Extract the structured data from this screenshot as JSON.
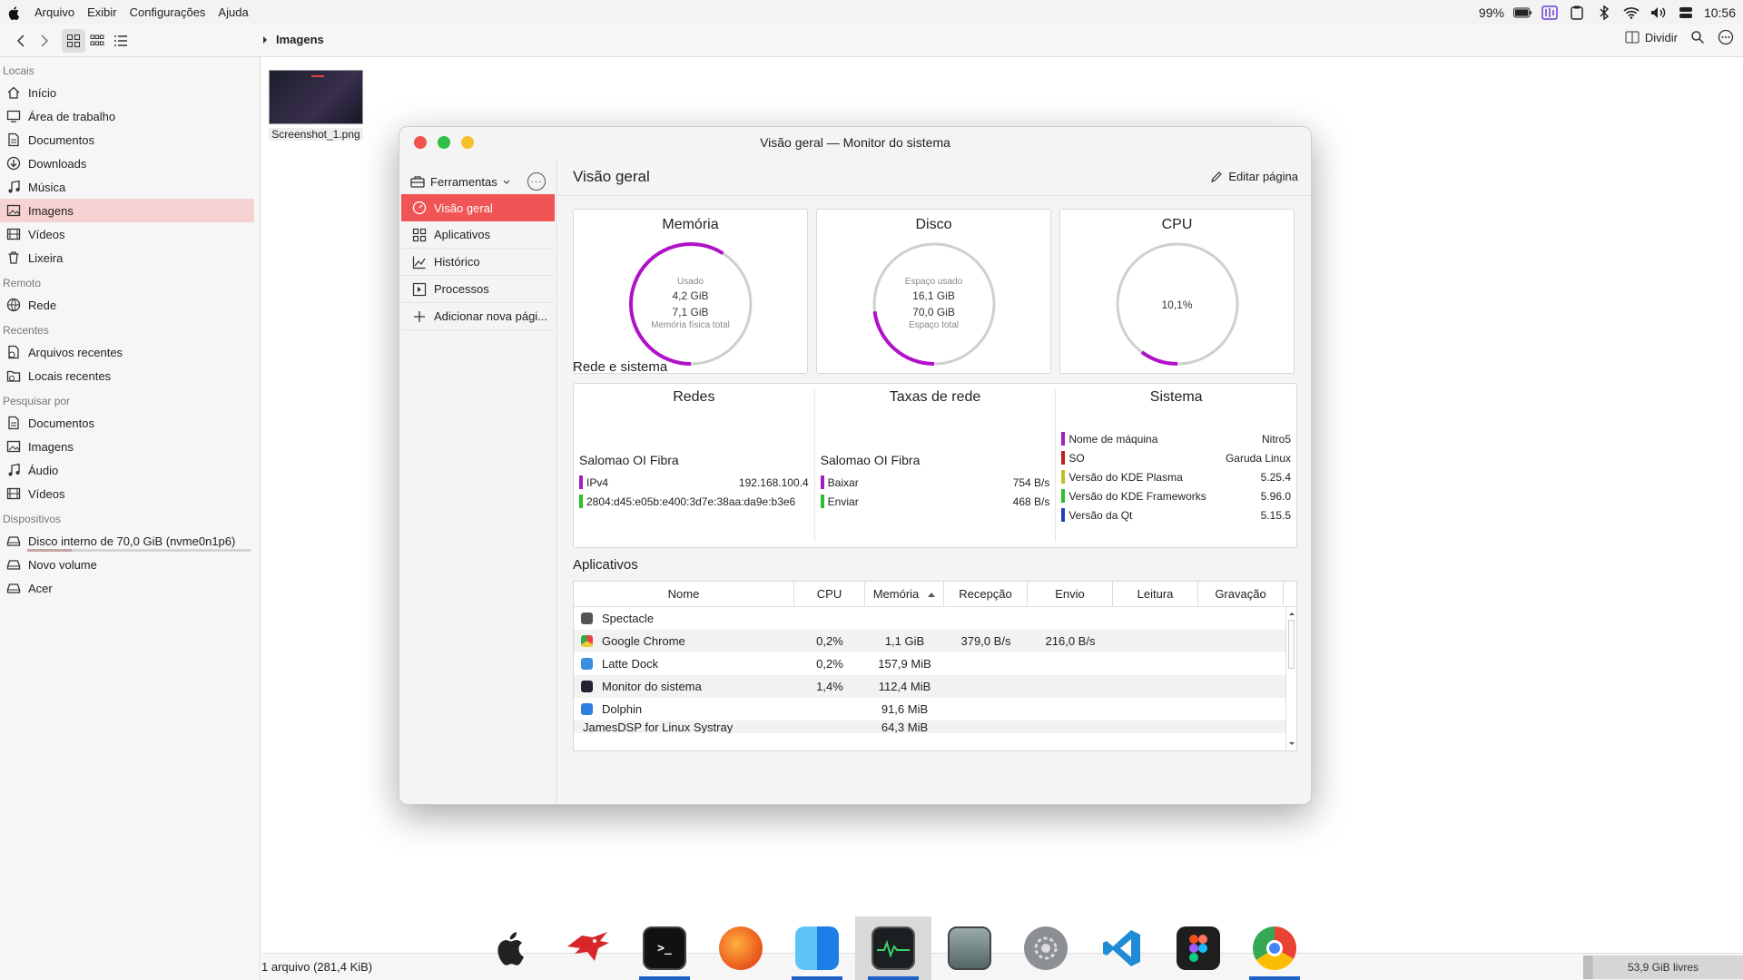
{
  "menubar": {
    "menus": [
      "Arquivo",
      "Exibir",
      "Configurações",
      "Ajuda"
    ],
    "battery": "99%",
    "clock": "10:56"
  },
  "toolbar": {
    "breadcrumb": "Imagens",
    "split_label": "Dividir"
  },
  "sidebar": {
    "sections": {
      "locais": "Locais",
      "remoto": "Remoto",
      "recentes": "Recentes",
      "pesquisar": "Pesquisar por",
      "dispositivos": "Dispositivos"
    },
    "locais": [
      "Início",
      "Área de trabalho",
      "Documentos",
      "Downloads",
      "Música",
      "Imagens",
      "Vídeos",
      "Lixeira"
    ],
    "remoto": [
      "Rede"
    ],
    "recentes": [
      "Arquivos recentes",
      "Locais recentes"
    ],
    "pesquisar": [
      "Documentos",
      "Imagens",
      "Áudio",
      "Vídeos"
    ],
    "dispositivos": [
      "Disco interno de 70,0 GiB (nvme0n1p6)",
      "Novo volume",
      "Acer"
    ],
    "selected": "Imagens"
  },
  "files": [
    {
      "name": "Screenshot_1.png"
    }
  ],
  "statusbar": {
    "summary": "1 arquivo (281,4 KiB)",
    "free": "53,9 GiB livres"
  },
  "window": {
    "title": "Visão geral — Monitor do sistema",
    "tools_label": "Ferramentas",
    "nav": [
      "Visão geral",
      "Aplicativos",
      "Histórico",
      "Processos",
      "Adicionar nova pági..."
    ],
    "page_title": "Visão geral",
    "edit_label": "Editar página",
    "cards": {
      "memory": {
        "title": "Memória",
        "used_label": "Usado",
        "used": "4,2 GiB",
        "total": "7,1 GiB",
        "total_label": "Memória física total",
        "fraction": 0.59
      },
      "disk": {
        "title": "Disco",
        "used_label": "Espaço usado",
        "used": "16,1 GiB",
        "total": "70,0 GiB",
        "total_label": "Espaço total",
        "fraction": 0.23
      },
      "cpu": {
        "title": "CPU",
        "value": "10,1%",
        "fraction": 0.101
      }
    },
    "net_section_title": "Rede e sistema",
    "networks": {
      "title": "Redes",
      "name": "Salomao OI Fibra",
      "rows": [
        {
          "label": "IPv4",
          "value": "192.168.100.4",
          "color": "#a020c0"
        },
        {
          "label": "2804:d45:e05b:e400:3d7e:38aa:da9e:b3e6",
          "value": "",
          "color": "#2cc02c"
        }
      ]
    },
    "rates": {
      "title": "Taxas de rede",
      "name": "Salomao OI Fibra",
      "rows": [
        {
          "label": "Baixar",
          "value": "754 B/s",
          "color": "#a020c0"
        },
        {
          "label": "Enviar",
          "value": "468 B/s",
          "color": "#2cc02c"
        }
      ]
    },
    "system": {
      "title": "Sistema",
      "rows": [
        {
          "label": "Nome de máquina",
          "value": "Nitro5",
          "color": "#a020c0"
        },
        {
          "label": "SO",
          "value": "Garuda Linux",
          "color": "#c02020"
        },
        {
          "label": "Versão do KDE Plasma",
          "value": "5.25.4",
          "color": "#c0c020"
        },
        {
          "label": "Versão do KDE Frameworks",
          "value": "5.96.0",
          "color": "#2cc02c"
        },
        {
          "label": "Versão da Qt",
          "value": "5.15.5",
          "color": "#2040c0"
        }
      ]
    },
    "apps_section_title": "Aplicativos",
    "table": {
      "headers": [
        "Nome",
        "CPU",
        "Memória",
        "Recepção",
        "Envio",
        "Leitura",
        "Gravação"
      ],
      "rows": [
        {
          "name": "Spectacle",
          "cpu": "",
          "mem": "",
          "rx": "",
          "tx": "",
          "icon": "#555"
        },
        {
          "name": "Google Chrome",
          "cpu": "0,2%",
          "mem": "1,1 GiB",
          "rx": "379,0 B/s",
          "tx": "216,0 B/s",
          "icon": "#e8a020"
        },
        {
          "name": "Latte Dock",
          "cpu": "0,2%",
          "mem": "157,9 MiB",
          "rx": "",
          "tx": "",
          "icon": "#3a8ee0"
        },
        {
          "name": "Monitor do sistema",
          "cpu": "1,4%",
          "mem": "112,4 MiB",
          "rx": "",
          "tx": "",
          "icon": "#223"
        },
        {
          "name": "Dolphin",
          "cpu": "",
          "mem": "91,6 MiB",
          "rx": "",
          "tx": "",
          "icon": "#2f7fe0"
        },
        {
          "name": "JamesDSP for Linux Systray",
          "cpu": "",
          "mem": "64,3 MiB",
          "rx": "",
          "tx": "",
          "icon": "#888"
        }
      ]
    }
  },
  "dock": [
    "apple",
    "garuda",
    "terminal",
    "firedragon",
    "finder",
    "system-monitor",
    "disks",
    "settings",
    "vscode",
    "figma",
    "chrome"
  ]
}
